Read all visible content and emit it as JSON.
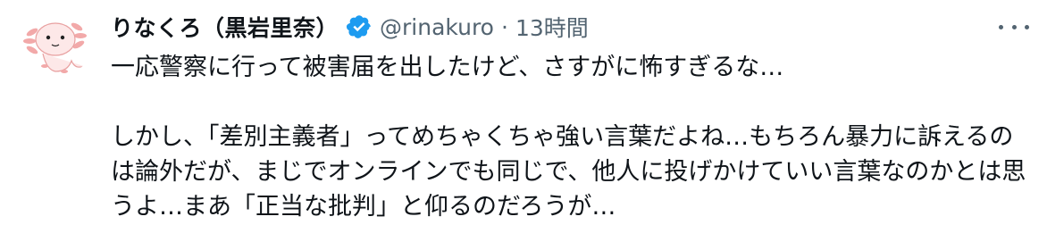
{
  "author": {
    "display_name": "りなくろ（黒岩里奈）",
    "handle": "@rinakuro",
    "separator": "·",
    "timestamp": "13時間",
    "verified": true,
    "verified_color": "#1d9bf0"
  },
  "tweet": {
    "paragraphs": [
      "一応警察に行って被害届を出したけど、さすがに怖すぎるな…",
      "しかし、「差別主義者」ってめちゃくちゃ強い言葉だよね…もちろん暴力に訴えるのは論外だが、まじでオンラインでも同じで、他人に投げかけていい言葉なのかとは思うよ…まあ「正当な批判」と仰るのだろうが…"
    ]
  },
  "icons": {
    "avatar": "axolotl-avatar",
    "verified": "verified-badge-icon",
    "more": "more-options-icon"
  }
}
